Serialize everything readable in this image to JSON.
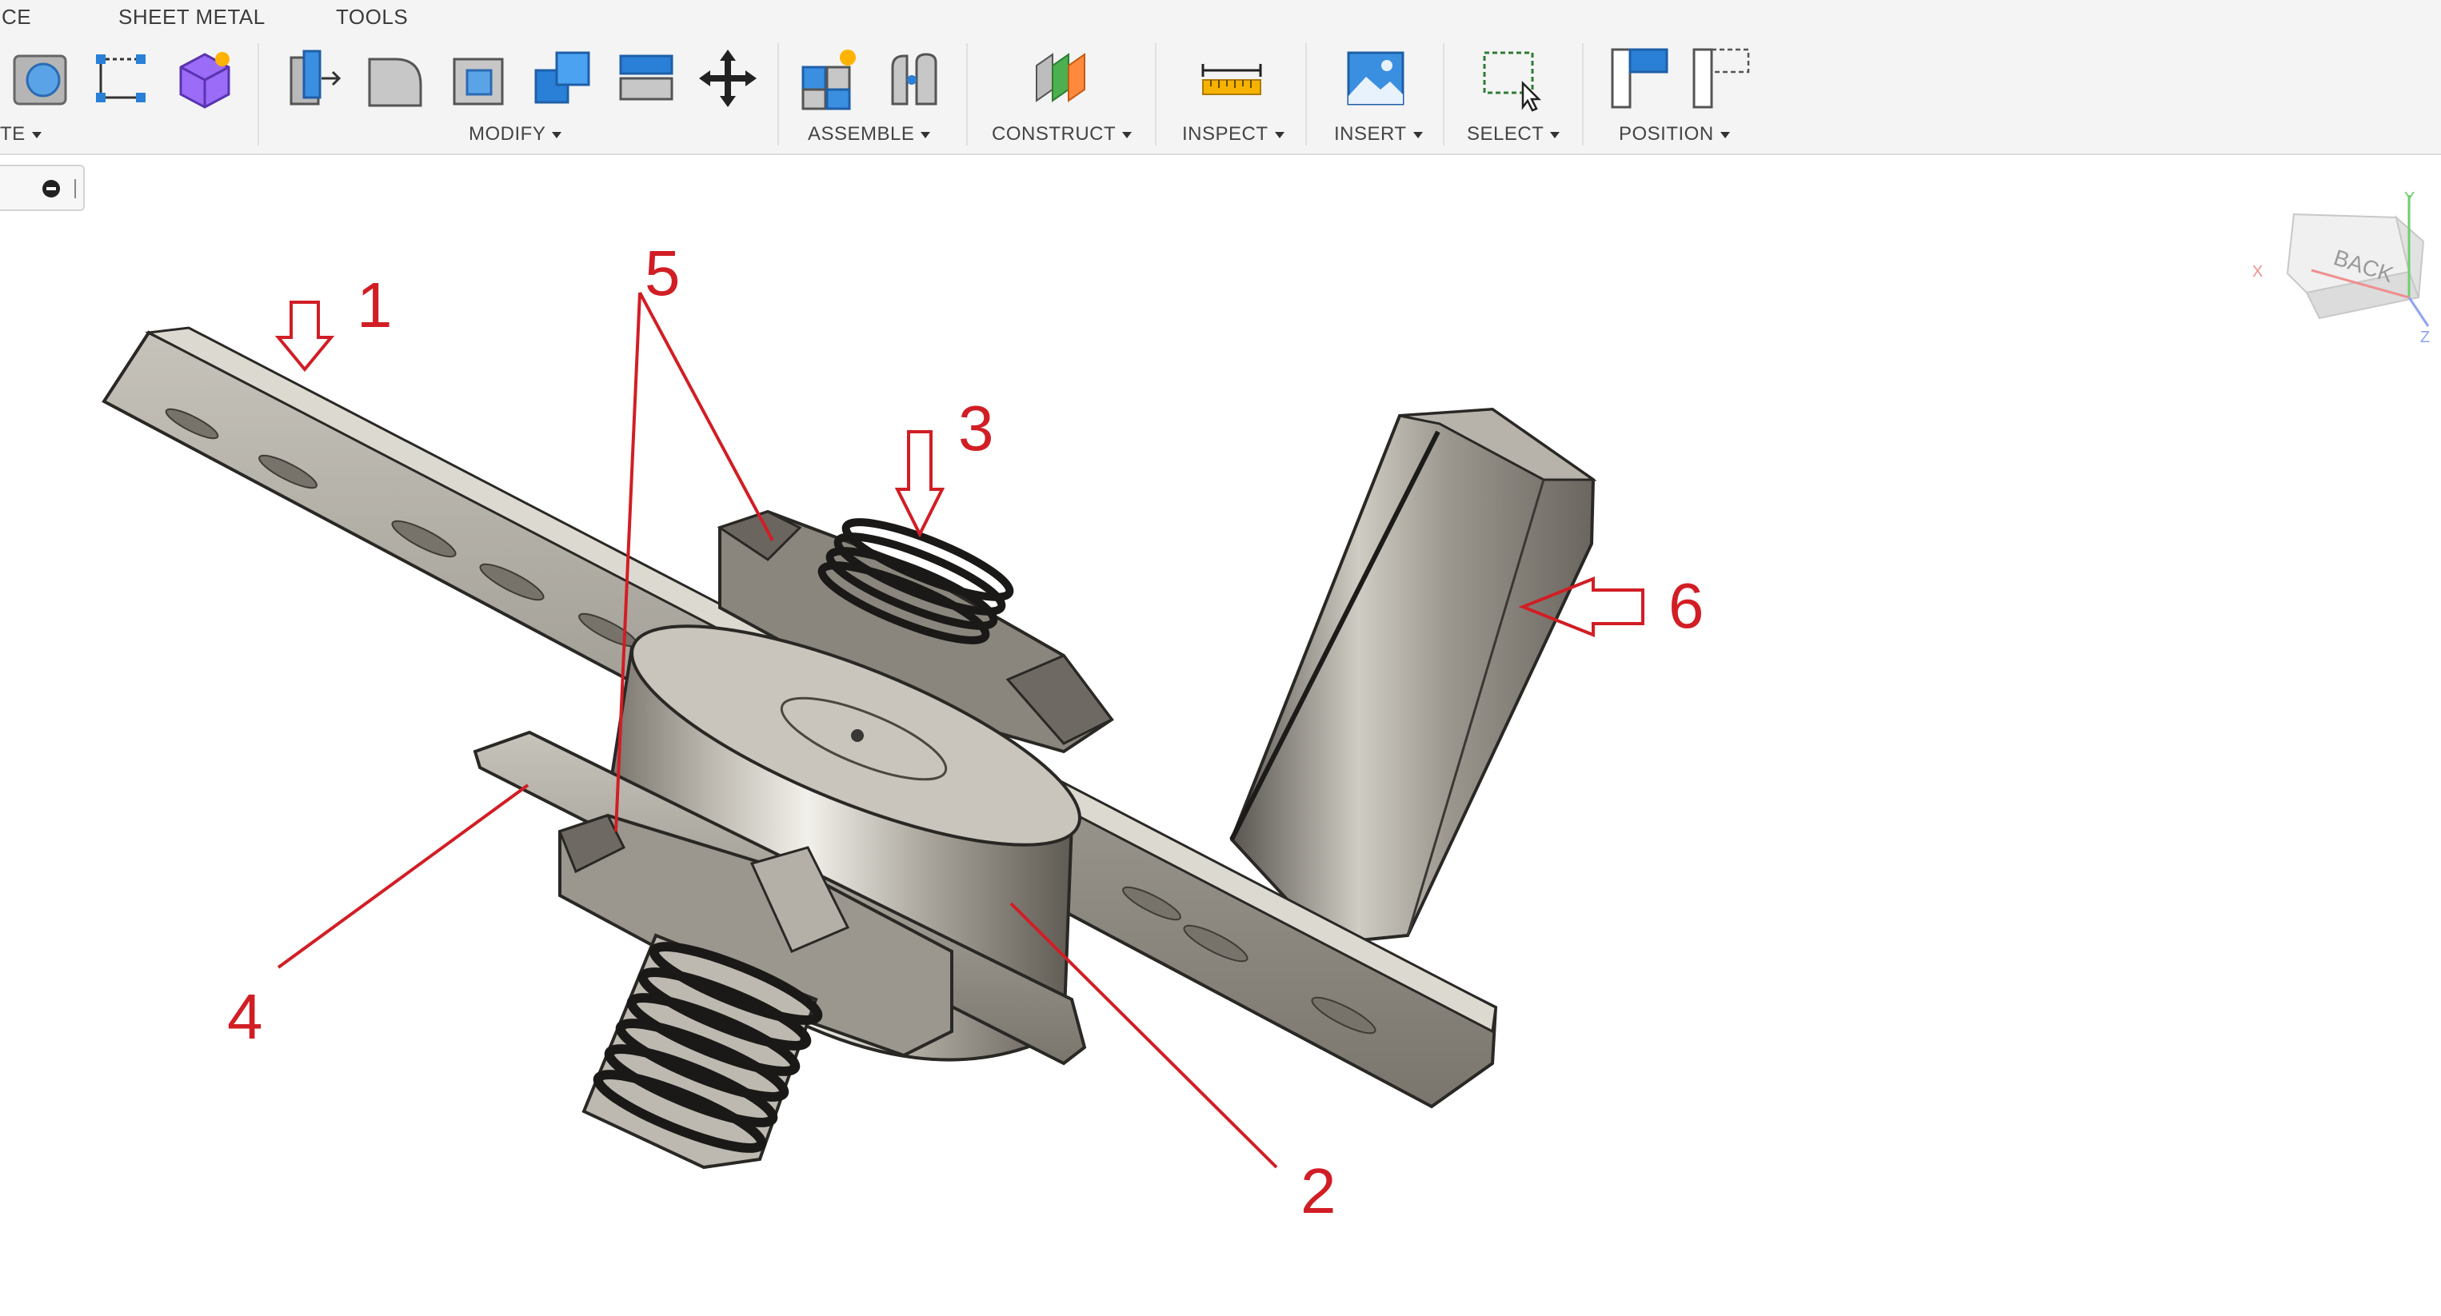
{
  "ribbon": {
    "tabs": [
      "CE",
      "SHEET METAL",
      "TOOLS"
    ],
    "groups": [
      {
        "label": "TE",
        "has_caret": true
      },
      {
        "label": "MODIFY",
        "has_caret": true
      },
      {
        "label": "ASSEMBLE",
        "has_caret": true
      },
      {
        "label": "CONSTRUCT",
        "has_caret": true
      },
      {
        "label": "INSPECT",
        "has_caret": true
      },
      {
        "label": "INSERT",
        "has_caret": true
      },
      {
        "label": "SELECT",
        "has_caret": true
      },
      {
        "label": "POSITION",
        "has_caret": true
      }
    ],
    "accent_blue": "#1e88e5",
    "accent_purple": "#8a5cf5"
  },
  "viewcube": {
    "face_label": "BACK",
    "axes": [
      "X",
      "Y",
      "Z"
    ]
  },
  "callouts": [
    "1",
    "2",
    "3",
    "4",
    "5",
    "6"
  ],
  "annotation_color": "#d11e25"
}
